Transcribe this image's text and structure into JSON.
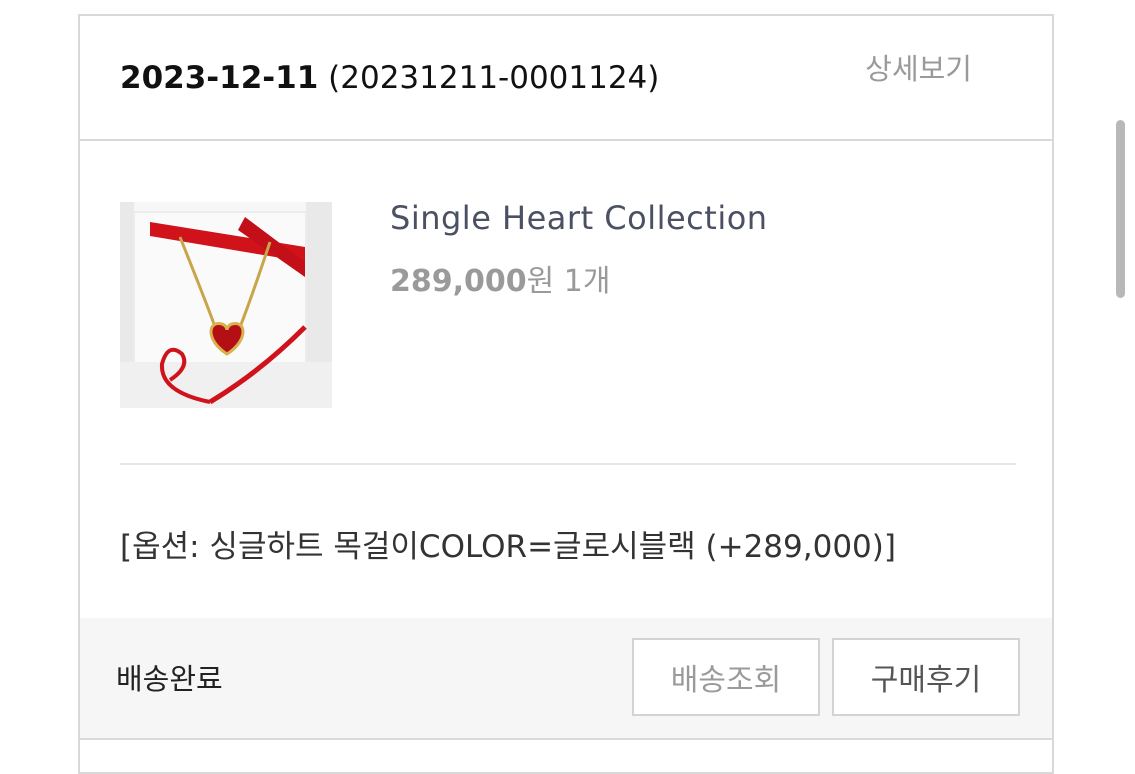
{
  "order": {
    "date": "2023-12-11",
    "number": "(20231211-0001124)",
    "detail_label": "상세보기"
  },
  "product": {
    "name": "Single Heart Collection",
    "price": "289,000",
    "currency": "원",
    "quantity": "1개",
    "image_icon": "necklace-product-image",
    "option": "[옵션: 싱글하트 목걸이COLOR=글로시블랙 (+289,000)]"
  },
  "footer": {
    "status": "배송완료",
    "track_label": "배송조회",
    "review_label": "구매후기"
  },
  "colors": {
    "border": "#d9d9d9",
    "product_name": "#4b5163",
    "muted": "#9a9a9a",
    "ribbon_red": "#d0121b"
  }
}
